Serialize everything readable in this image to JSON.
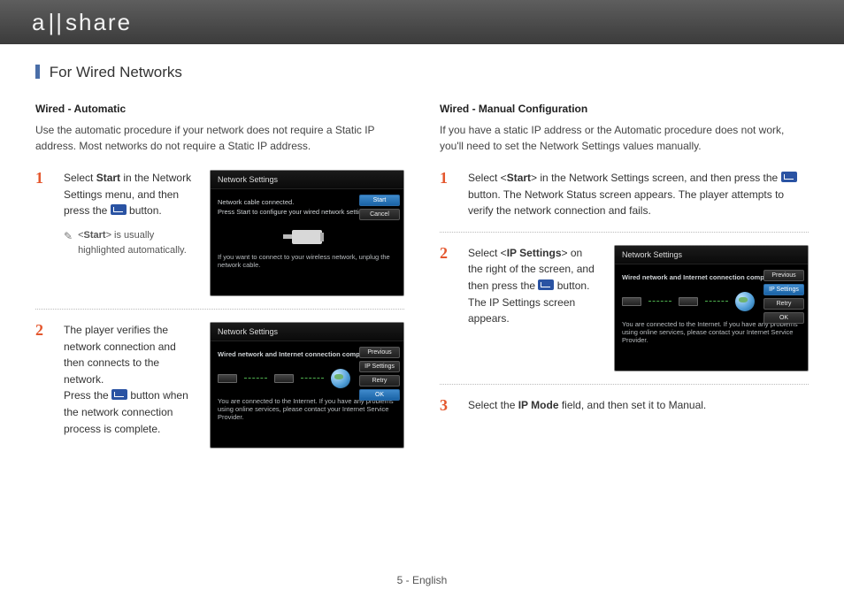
{
  "brand": "allshare",
  "section_title": "For Wired Networks",
  "page_number": "5 - English",
  "left": {
    "heading": "Wired - Automatic",
    "intro": "Use the automatic procedure if your network does not require a Static IP address. Most networks do not require a Static IP address.",
    "step1": {
      "pre": "Select ",
      "bold": "Start",
      "post": " in the Network Settings menu, and then press the ",
      "after_btn": " button.",
      "note_pre": "<",
      "note_bold": "Start",
      "note_post": "> is usually highlighted automatically."
    },
    "step2": {
      "a": "The player verifies the network connection and then connects to the network.",
      "b_pre": "Press the ",
      "b_post": " button when the network connection process is complete."
    },
    "screenshot1": {
      "title": "Network Settings",
      "line1": "Network cable connected.",
      "line2": "Press Start to configure your wired network settings.",
      "hint": "If you want to connect to your wireless network, unplug the network cable.",
      "btn_start": "Start",
      "btn_cancel": "Cancel"
    },
    "screenshot2": {
      "title": "Network Settings",
      "status": "Wired network and Internet connection complete.",
      "footer": "You are connected to the Internet. If you have any problems using online services, please contact your Internet Service Provider.",
      "btn_prev": "Previous",
      "btn_ip": "IP Settings",
      "btn_retry": "Retry",
      "btn_ok": "OK"
    }
  },
  "right": {
    "heading": "Wired - Manual Configuration",
    "intro": "If you have a static IP address or the Automatic procedure does not work, you'll need to set the Network Settings values manually.",
    "step1": {
      "pre": "Select <",
      "bold": "Start",
      "mid": "> in the Network Settings screen, and then press the ",
      "post": " button. The Network Status screen appears. The player attempts to verify the network connection and fails."
    },
    "step2": {
      "pre": "Select <",
      "bold": "IP Settings",
      "mid": "> on the right of the screen, and then press the ",
      "post": " button. The IP Settings screen appears."
    },
    "step3": {
      "pre": "Select the ",
      "bold": "IP Mode",
      "post": " field, and then set it to Manual."
    },
    "screenshot": {
      "title": "Network Settings",
      "status": "Wired network and Internet connection complete.",
      "footer": "You are connected to the Internet. If you have any problems using online services, please contact your Internet Service Provider.",
      "btn_prev": "Previous",
      "btn_ip": "IP Settings",
      "btn_retry": "Retry",
      "btn_ok": "OK"
    }
  }
}
